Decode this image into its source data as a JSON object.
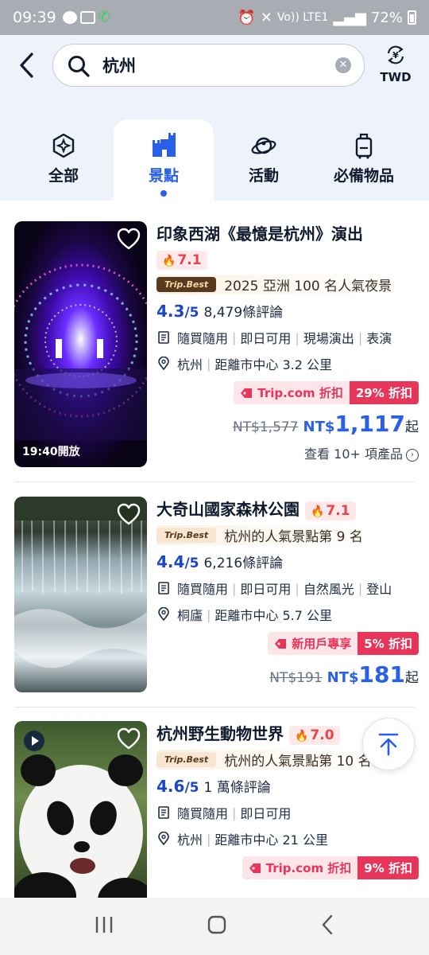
{
  "status_bar": {
    "time": "09:39",
    "network": "Vo)) LTE1",
    "battery": "72%"
  },
  "header": {
    "search_value": "杭州",
    "currency": "TWD"
  },
  "tabs": [
    {
      "label": "全部",
      "icon": "all-sparkle-icon",
      "active": false
    },
    {
      "label": "景點",
      "icon": "attraction-castle-icon",
      "active": true
    },
    {
      "label": "活動",
      "icon": "activity-planet-icon",
      "active": false
    },
    {
      "label": "必備物品",
      "icon": "luggage-icon",
      "active": false
    }
  ],
  "cards": [
    {
      "title": "印象西湖《最憶是杭州》演出",
      "hot": "7.1",
      "badge": "Trip.Best",
      "award": "2025 亞洲 100 名人氣夜景",
      "score": "4.3",
      "score_max": "/5",
      "reviews": "8,479條評論",
      "features": [
        "隨買隨用",
        "即日可用",
        "現場演出",
        "表演"
      ],
      "location": "杭州",
      "distance": "距離市中心 3.2 公里",
      "promo_label": "Trip.com 折扣",
      "promo_pct": "29% 折扣",
      "old_price": "NT$1,577",
      "currency": "NT$",
      "price": "1,117",
      "suffix": "起",
      "thumb_badge": "19:40開放",
      "more": "查看 10+ 項產品"
    },
    {
      "title": "大奇山國家森林公園",
      "hot": "7.1",
      "badge": "Trip.Best",
      "award": "杭州的人氣景點第 9 名",
      "score": "4.4",
      "score_max": "/5",
      "reviews": "6,216條評論",
      "features": [
        "隨買隨用",
        "即日可用",
        "自然風光",
        "登山"
      ],
      "location": "桐廬",
      "distance": "距離市中心 5.7 公里",
      "promo_label": "新用戶專享",
      "promo_pct": "5% 折扣",
      "old_price": "NT$191",
      "currency": "NT$",
      "price": "181",
      "suffix": "起"
    },
    {
      "title": "杭州野生動物世界",
      "hot": "7.0",
      "badge": "Trip.Best",
      "award": "杭州的人氣景點第 10 名",
      "score": "4.6",
      "score_max": "/5",
      "reviews": "1 萬條評論",
      "features": [
        "隨買隨用",
        "即日可用"
      ],
      "location": "杭州",
      "distance": "距離市中心 21 公里",
      "promo_label": "Trip.com 折扣",
      "promo_pct": "9% 折扣"
    }
  ],
  "colors": {
    "accent": "#2a5fe8",
    "hot": "#e8434f",
    "promo": "#e8355a",
    "header_bg": "#eef2fb"
  }
}
